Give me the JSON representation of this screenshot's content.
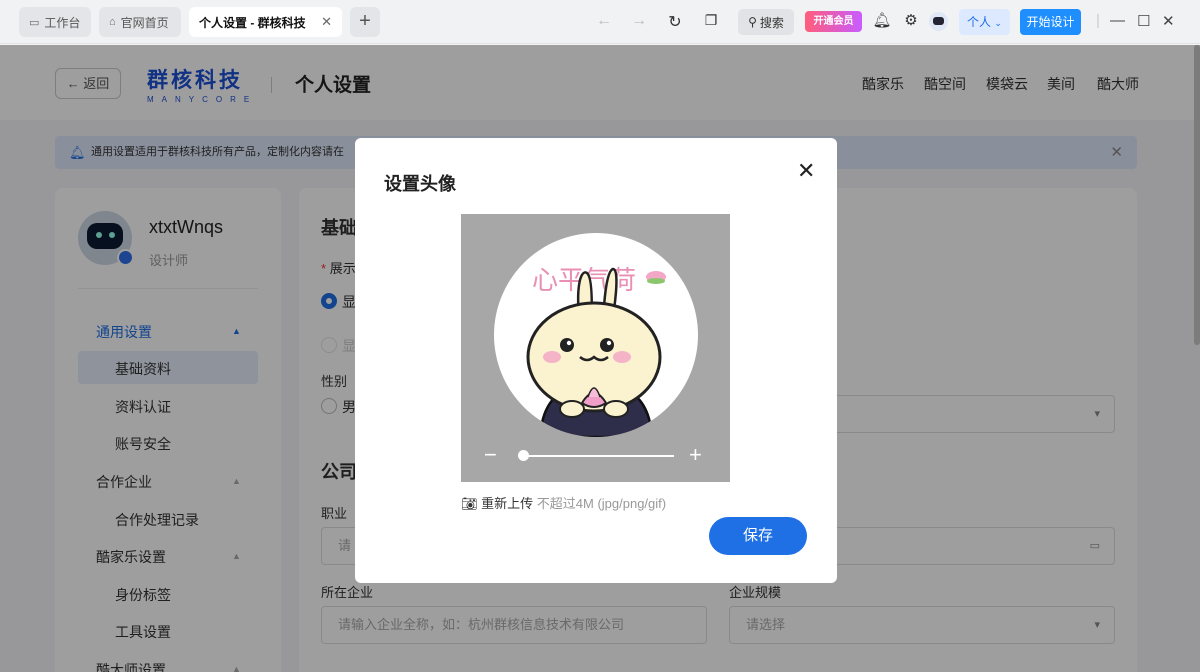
{
  "browser": {
    "tabs": [
      {
        "label": "工作台",
        "active": false
      },
      {
        "label": "官网首页",
        "active": false
      },
      {
        "label": "个人设置 - 群核科技",
        "active": true
      }
    ],
    "new_tab": "+",
    "search_label": "搜索",
    "vip_label": "开通会员",
    "personal_label": "个人",
    "start_design_label": "开始设计",
    "icons": [
      "back-arrow",
      "forward-arrow",
      "refresh",
      "copy",
      "search",
      "bell",
      "gear",
      "robot"
    ]
  },
  "header": {
    "back_label": "← 返回",
    "brand_name": "群核科技",
    "brand_en": "MANYCORE",
    "page_title": "个人设置",
    "links": [
      "酷家乐",
      "酷空间",
      "模袋云",
      "美间",
      "酷大师"
    ]
  },
  "notice": {
    "text": "通用设置适用于群核科技所有产品，定制化内容请在"
  },
  "sidebar": {
    "username": "xtxtWnqs",
    "role": "设计师",
    "menu": [
      {
        "label": "通用设置",
        "level": 1,
        "active": true,
        "expanded": true
      },
      {
        "label": "基础资料",
        "level": 2,
        "selected": true
      },
      {
        "label": "资料认证",
        "level": 2
      },
      {
        "label": "账号安全",
        "level": 2
      },
      {
        "label": "合作企业",
        "level": 1
      },
      {
        "label": "合作处理记录",
        "level": 2
      },
      {
        "label": "酷家乐设置",
        "level": 1
      },
      {
        "label": "身份标签",
        "level": 2
      },
      {
        "label": "工具设置",
        "level": 2
      },
      {
        "label": "酷大师设置",
        "level": 1
      }
    ]
  },
  "main": {
    "section_basic": "基础",
    "display_label": "展示",
    "required_mark": "*",
    "display_option": "显",
    "display_option_disabled": "显",
    "gender_label": "性别",
    "gender_option": "男",
    "section_company": "公司",
    "job_label": "职业",
    "job_placeholder": "请",
    "company_label": "所在企业",
    "company_placeholder": "请输入企业全称，如：杭州群核信息技术有限公司",
    "scale_label": "企业规模",
    "scale_placeholder": "请选择"
  },
  "modal": {
    "title": "设置头像",
    "close": "✕",
    "image_text": "心平气荷",
    "zoom_minus": "−",
    "zoom_plus": "+",
    "zoom_level": 0.03,
    "reupload_label": "重新上传",
    "reupload_hint": "不超过4M (jpg/png/gif)",
    "save_label": "保存"
  }
}
